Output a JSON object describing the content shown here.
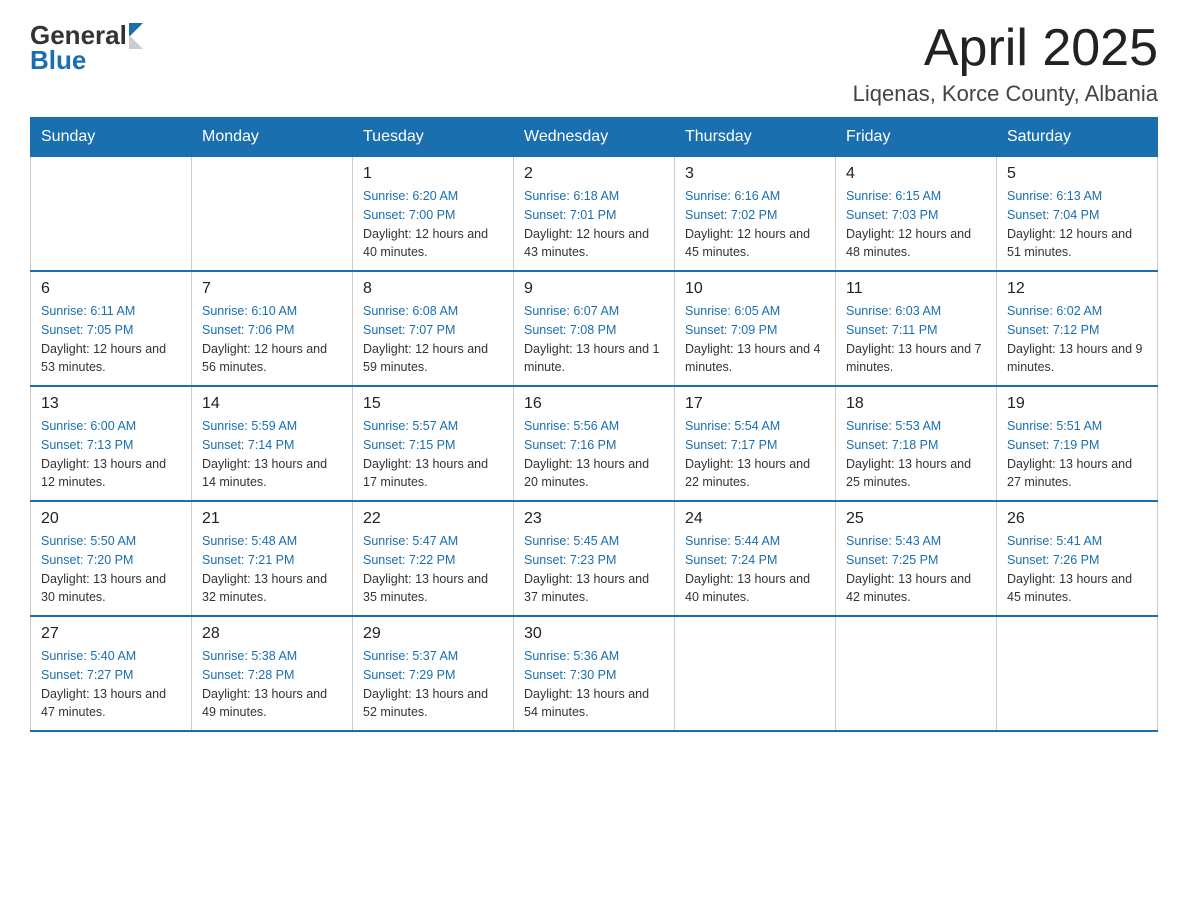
{
  "header": {
    "logo_general": "General",
    "logo_blue": "Blue",
    "month_title": "April 2025",
    "location": "Liqenas, Korce County, Albania"
  },
  "calendar": {
    "days_of_week": [
      "Sunday",
      "Monday",
      "Tuesday",
      "Wednesday",
      "Thursday",
      "Friday",
      "Saturday"
    ],
    "weeks": [
      [
        {
          "day": "",
          "sunrise": "",
          "sunset": "",
          "daylight": ""
        },
        {
          "day": "",
          "sunrise": "",
          "sunset": "",
          "daylight": ""
        },
        {
          "day": "1",
          "sunrise": "Sunrise: 6:20 AM",
          "sunset": "Sunset: 7:00 PM",
          "daylight": "Daylight: 12 hours and 40 minutes."
        },
        {
          "day": "2",
          "sunrise": "Sunrise: 6:18 AM",
          "sunset": "Sunset: 7:01 PM",
          "daylight": "Daylight: 12 hours and 43 minutes."
        },
        {
          "day": "3",
          "sunrise": "Sunrise: 6:16 AM",
          "sunset": "Sunset: 7:02 PM",
          "daylight": "Daylight: 12 hours and 45 minutes."
        },
        {
          "day": "4",
          "sunrise": "Sunrise: 6:15 AM",
          "sunset": "Sunset: 7:03 PM",
          "daylight": "Daylight: 12 hours and 48 minutes."
        },
        {
          "day": "5",
          "sunrise": "Sunrise: 6:13 AM",
          "sunset": "Sunset: 7:04 PM",
          "daylight": "Daylight: 12 hours and 51 minutes."
        }
      ],
      [
        {
          "day": "6",
          "sunrise": "Sunrise: 6:11 AM",
          "sunset": "Sunset: 7:05 PM",
          "daylight": "Daylight: 12 hours and 53 minutes."
        },
        {
          "day": "7",
          "sunrise": "Sunrise: 6:10 AM",
          "sunset": "Sunset: 7:06 PM",
          "daylight": "Daylight: 12 hours and 56 minutes."
        },
        {
          "day": "8",
          "sunrise": "Sunrise: 6:08 AM",
          "sunset": "Sunset: 7:07 PM",
          "daylight": "Daylight: 12 hours and 59 minutes."
        },
        {
          "day": "9",
          "sunrise": "Sunrise: 6:07 AM",
          "sunset": "Sunset: 7:08 PM",
          "daylight": "Daylight: 13 hours and 1 minute."
        },
        {
          "day": "10",
          "sunrise": "Sunrise: 6:05 AM",
          "sunset": "Sunset: 7:09 PM",
          "daylight": "Daylight: 13 hours and 4 minutes."
        },
        {
          "day": "11",
          "sunrise": "Sunrise: 6:03 AM",
          "sunset": "Sunset: 7:11 PM",
          "daylight": "Daylight: 13 hours and 7 minutes."
        },
        {
          "day": "12",
          "sunrise": "Sunrise: 6:02 AM",
          "sunset": "Sunset: 7:12 PM",
          "daylight": "Daylight: 13 hours and 9 minutes."
        }
      ],
      [
        {
          "day": "13",
          "sunrise": "Sunrise: 6:00 AM",
          "sunset": "Sunset: 7:13 PM",
          "daylight": "Daylight: 13 hours and 12 minutes."
        },
        {
          "day": "14",
          "sunrise": "Sunrise: 5:59 AM",
          "sunset": "Sunset: 7:14 PM",
          "daylight": "Daylight: 13 hours and 14 minutes."
        },
        {
          "day": "15",
          "sunrise": "Sunrise: 5:57 AM",
          "sunset": "Sunset: 7:15 PM",
          "daylight": "Daylight: 13 hours and 17 minutes."
        },
        {
          "day": "16",
          "sunrise": "Sunrise: 5:56 AM",
          "sunset": "Sunset: 7:16 PM",
          "daylight": "Daylight: 13 hours and 20 minutes."
        },
        {
          "day": "17",
          "sunrise": "Sunrise: 5:54 AM",
          "sunset": "Sunset: 7:17 PM",
          "daylight": "Daylight: 13 hours and 22 minutes."
        },
        {
          "day": "18",
          "sunrise": "Sunrise: 5:53 AM",
          "sunset": "Sunset: 7:18 PM",
          "daylight": "Daylight: 13 hours and 25 minutes."
        },
        {
          "day": "19",
          "sunrise": "Sunrise: 5:51 AM",
          "sunset": "Sunset: 7:19 PM",
          "daylight": "Daylight: 13 hours and 27 minutes."
        }
      ],
      [
        {
          "day": "20",
          "sunrise": "Sunrise: 5:50 AM",
          "sunset": "Sunset: 7:20 PM",
          "daylight": "Daylight: 13 hours and 30 minutes."
        },
        {
          "day": "21",
          "sunrise": "Sunrise: 5:48 AM",
          "sunset": "Sunset: 7:21 PM",
          "daylight": "Daylight: 13 hours and 32 minutes."
        },
        {
          "day": "22",
          "sunrise": "Sunrise: 5:47 AM",
          "sunset": "Sunset: 7:22 PM",
          "daylight": "Daylight: 13 hours and 35 minutes."
        },
        {
          "day": "23",
          "sunrise": "Sunrise: 5:45 AM",
          "sunset": "Sunset: 7:23 PM",
          "daylight": "Daylight: 13 hours and 37 minutes."
        },
        {
          "day": "24",
          "sunrise": "Sunrise: 5:44 AM",
          "sunset": "Sunset: 7:24 PM",
          "daylight": "Daylight: 13 hours and 40 minutes."
        },
        {
          "day": "25",
          "sunrise": "Sunrise: 5:43 AM",
          "sunset": "Sunset: 7:25 PM",
          "daylight": "Daylight: 13 hours and 42 minutes."
        },
        {
          "day": "26",
          "sunrise": "Sunrise: 5:41 AM",
          "sunset": "Sunset: 7:26 PM",
          "daylight": "Daylight: 13 hours and 45 minutes."
        }
      ],
      [
        {
          "day": "27",
          "sunrise": "Sunrise: 5:40 AM",
          "sunset": "Sunset: 7:27 PM",
          "daylight": "Daylight: 13 hours and 47 minutes."
        },
        {
          "day": "28",
          "sunrise": "Sunrise: 5:38 AM",
          "sunset": "Sunset: 7:28 PM",
          "daylight": "Daylight: 13 hours and 49 minutes."
        },
        {
          "day": "29",
          "sunrise": "Sunrise: 5:37 AM",
          "sunset": "Sunset: 7:29 PM",
          "daylight": "Daylight: 13 hours and 52 minutes."
        },
        {
          "day": "30",
          "sunrise": "Sunrise: 5:36 AM",
          "sunset": "Sunset: 7:30 PM",
          "daylight": "Daylight: 13 hours and 54 minutes."
        },
        {
          "day": "",
          "sunrise": "",
          "sunset": "",
          "daylight": ""
        },
        {
          "day": "",
          "sunrise": "",
          "sunset": "",
          "daylight": ""
        },
        {
          "day": "",
          "sunrise": "",
          "sunset": "",
          "daylight": ""
        }
      ]
    ]
  }
}
